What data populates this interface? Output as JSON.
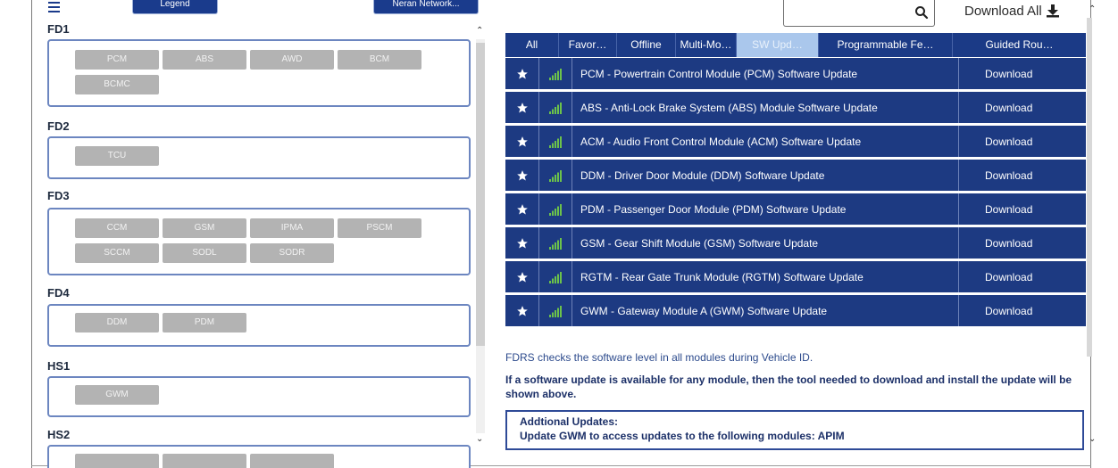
{
  "left": {
    "legend_label": "Legend",
    "network_label": "Neran Network...",
    "groups": [
      {
        "name": "FD1",
        "modules": [
          "PCM",
          "ABS",
          "AWD",
          "BCM",
          "BCMC"
        ]
      },
      {
        "name": "FD2",
        "modules": [
          "TCU"
        ]
      },
      {
        "name": "FD3",
        "modules": [
          "CCM",
          "GSM",
          "IPMA",
          "PSCM",
          "SCCM",
          "SODL",
          "SODR"
        ]
      },
      {
        "name": "FD4",
        "modules": [
          "DDM",
          "PDM"
        ]
      },
      {
        "name": "HS1",
        "modules": [
          "GWM"
        ]
      },
      {
        "name": "HS2",
        "modules": []
      }
    ]
  },
  "toolbar": {
    "search_placeholder": "",
    "download_all_label": "Download All"
  },
  "tabs": [
    {
      "label": "All",
      "active": false
    },
    {
      "label": "Favor…",
      "active": false
    },
    {
      "label": "Offline",
      "active": false
    },
    {
      "label": "Multi-Mo…",
      "active": false
    },
    {
      "label": "SW Upd…",
      "active": true
    },
    {
      "label": "Programmable Fe…",
      "active": false
    },
    {
      "label": "Guided Rou…",
      "active": false
    }
  ],
  "updates": [
    {
      "title": "PCM - Powertrain Control Module (PCM) Software Update",
      "action": "Download"
    },
    {
      "title": "ABS - Anti-Lock Brake System (ABS) Module Software Update",
      "action": "Download"
    },
    {
      "title": "ACM - Audio Front Control Module (ACM) Software Update",
      "action": "Download"
    },
    {
      "title": "DDM - Driver Door Module (DDM) Software Update",
      "action": "Download"
    },
    {
      "title": "PDM - Passenger Door Module (PDM) Software Update",
      "action": "Download"
    },
    {
      "title": "GSM - Gear Shift Module (GSM) Software Update",
      "action": "Download"
    },
    {
      "title": "RGTM - Rear Gate Trunk Module (RGTM) Software Update",
      "action": "Download"
    },
    {
      "title": "GWM - Gateway Module A (GWM) Software Update",
      "action": "Download"
    }
  ],
  "info": {
    "line1": "FDRS checks the software level in all modules during Vehicle ID.",
    "line2": "If a software update is available for any module, then the tool needed to download and install the update will be shown above."
  },
  "additional": {
    "heading": "Addtional Updates:",
    "text": "Update GWM to access updates to the following modules: APIM"
  },
  "colors": {
    "accent": "#1b3a86",
    "active_tab": "#aac7ec",
    "chip": "#b3b3b3",
    "signal": "#6cc24a"
  }
}
